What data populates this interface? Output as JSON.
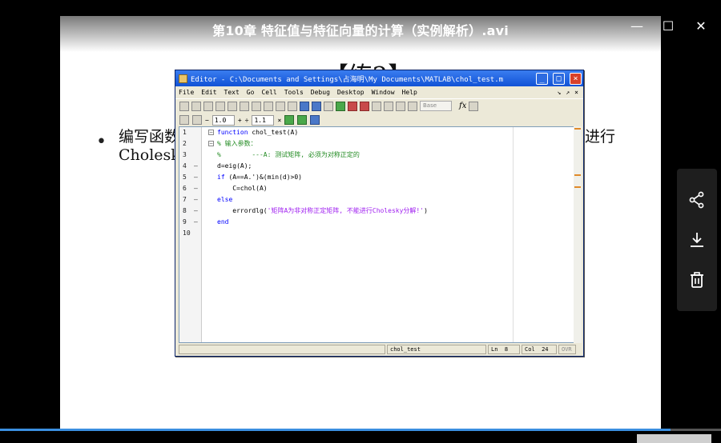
{
  "window": {
    "title": "第10章  特征值与特征向量的计算（实例解析）.avi",
    "minimize_glyph": "—",
    "maximize_glyph": "☐",
    "close_glyph": "✕"
  },
  "slide": {
    "heading": "【练2】",
    "bullet": "•",
    "line1": "编写函数",
    "line2": "Cholesky",
    "line1_tail": "进行"
  },
  "editor": {
    "title": "Editor - C:\\Documents and Settings\\占海明\\My Documents\\MATLAB\\chol_test.m",
    "title_buttons": [
      "_",
      "□",
      "×"
    ],
    "menus": [
      "File",
      "Edit",
      "Text",
      "Go",
      "Cell",
      "Tools",
      "Debug",
      "Desktop",
      "Window",
      "Help"
    ],
    "menu_right": [
      "↘",
      "↗",
      "×"
    ],
    "toolbar": {
      "base_placeholder": "Base",
      "fx": "fx"
    },
    "cell_toolbar": {
      "minus": "−",
      "value1": "1.0",
      "plus": "+",
      "divide": "÷",
      "value2": "1.1",
      "times": "×"
    },
    "line_numbers": [
      "1",
      "2",
      "3",
      "4",
      "5",
      "6",
      "7",
      "8",
      "9",
      "10"
    ],
    "code": [
      {
        "kw": "function",
        "rest": " chol_test(A)"
      },
      {
        "cm": "% 输入参数："
      },
      {
        "cm": "%        ---A: 测试矩阵, 必须为对称正定的"
      },
      {
        "text": "d=eig(A);"
      },
      {
        "kw": "if",
        "rest": " (A==A.')&(min(d)>0)"
      },
      {
        "text": "    C=chol(A)"
      },
      {
        "kw": "else",
        "rest": ""
      },
      {
        "pre": "    errordlg(",
        "str": "'矩阵A为非对称正定矩阵, 不能进行Cholesky分解!'",
        "post": ")"
      },
      {
        "kw": "end",
        "rest": ""
      },
      {
        "text": ""
      }
    ],
    "status": {
      "func": "chol_test",
      "ln_label": "Ln",
      "ln": "8",
      "col_label": "Col",
      "col": "24",
      "ovr": "OVR"
    }
  },
  "share_panel": {
    "items": [
      "share-icon",
      "download-icon",
      "trash-icon"
    ]
  },
  "playback": {
    "progress": 0.93
  }
}
